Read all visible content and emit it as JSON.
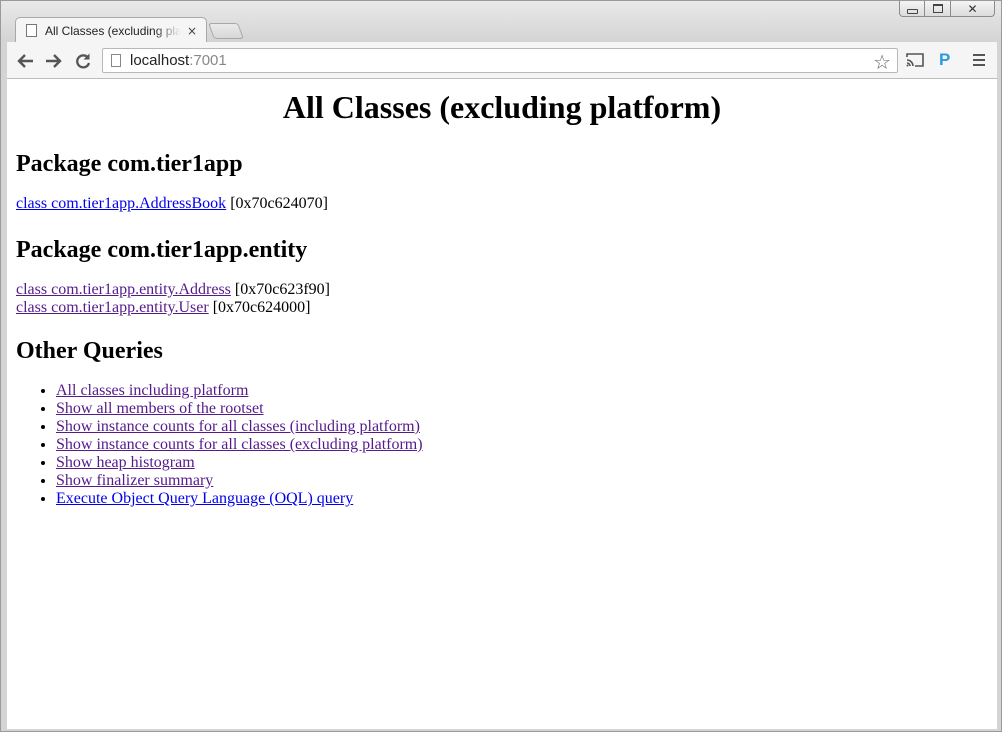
{
  "browser": {
    "tab_title": "All Classes (excluding platform)",
    "tab_close": "×",
    "url_host": "localhost",
    "url_port": ":7001",
    "extension_label": "P",
    "window_close": "✕"
  },
  "page": {
    "title": "All Classes (excluding platform)",
    "sections": [
      {
        "heading": "Package com.tier1app",
        "items": [
          {
            "link": "class com.tier1app.AddressBook",
            "address": "[0x70c624070]"
          }
        ]
      },
      {
        "heading": "Package com.tier1app.entity",
        "items": [
          {
            "link": "class com.tier1app.entity.Address",
            "address": "[0x70c623f90]"
          },
          {
            "link": "class com.tier1app.entity.User",
            "address": "[0x70c624000]"
          }
        ]
      }
    ],
    "other_queries": {
      "heading": "Other Queries",
      "links": [
        "All classes including platform",
        "Show all members of the rootset",
        "Show instance counts for all classes (including platform)",
        "Show instance counts for all classes (excluding platform)",
        "Show heap histogram",
        "Show finalizer summary",
        "Execute Object Query Language (OQL) query"
      ]
    }
  },
  "colors": {
    "link": "#0000ee",
    "visited_link": "#551a8b",
    "extension_accent": "#2b9bd8"
  }
}
